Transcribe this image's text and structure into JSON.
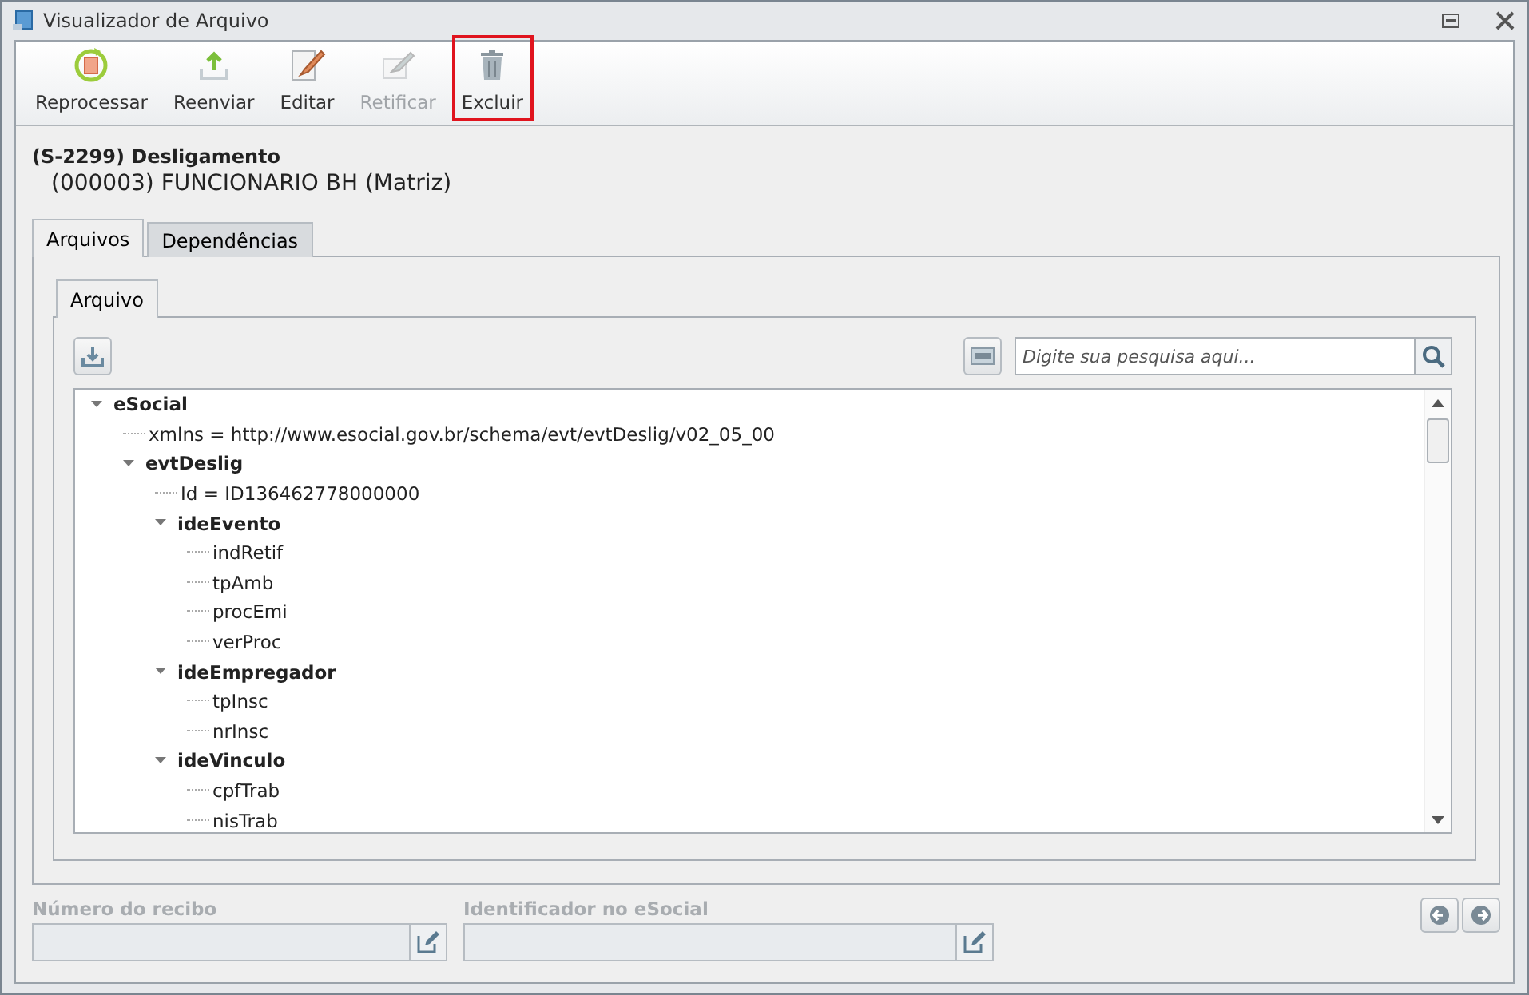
{
  "window": {
    "title": "Visualizador de Arquivo"
  },
  "toolbar": [
    {
      "kind": "reprocess",
      "label": "Reprocessar",
      "disabled": false,
      "highlighted": false
    },
    {
      "kind": "upload",
      "label": "Reenviar",
      "disabled": false,
      "highlighted": false
    },
    {
      "kind": "edit",
      "label": "Editar",
      "disabled": false,
      "highlighted": false
    },
    {
      "kind": "rectify",
      "label": "Retificar",
      "disabled": true,
      "highlighted": false
    },
    {
      "kind": "delete",
      "label": "Excluir",
      "disabled": false,
      "highlighted": true
    }
  ],
  "header": {
    "event": "(S-2299) Desligamento",
    "employer": "(000003) FUNCIONARIO BH (Matriz)"
  },
  "tabs": [
    {
      "label": "Arquivos",
      "selected": true
    },
    {
      "label": "Dependências",
      "selected": false
    }
  ],
  "inner_tabs": [
    {
      "label": "Arquivo",
      "selected": true
    }
  ],
  "search": {
    "placeholder": "Digite sua pesquisa aqui..."
  },
  "tree": [
    {
      "label": "eSocial",
      "expanded": true,
      "children": [
        {
          "label": "xmlns = http://www.esocial.gov.br/schema/evt/evtDeslig/v02_05_00"
        },
        {
          "label": "evtDeslig",
          "expanded": true,
          "children": [
            {
              "label": "Id = ID136462778000000"
            },
            {
              "label": "ideEvento",
              "expanded": true,
              "children": [
                {
                  "label": "indRetif"
                },
                {
                  "label": "tpAmb"
                },
                {
                  "label": "procEmi"
                },
                {
                  "label": "verProc"
                }
              ]
            },
            {
              "label": "ideEmpregador",
              "expanded": true,
              "children": [
                {
                  "label": "tpInsc"
                },
                {
                  "label": "nrInsc"
                }
              ]
            },
            {
              "label": "ideVinculo",
              "expanded": true,
              "children": [
                {
                  "label": "cpfTrab"
                },
                {
                  "label": "nisTrab"
                }
              ]
            }
          ]
        }
      ]
    }
  ],
  "fields": [
    {
      "label": "Número do recibo",
      "disabled": true
    },
    {
      "label": "Identificador no eSocial",
      "disabled": true
    }
  ]
}
